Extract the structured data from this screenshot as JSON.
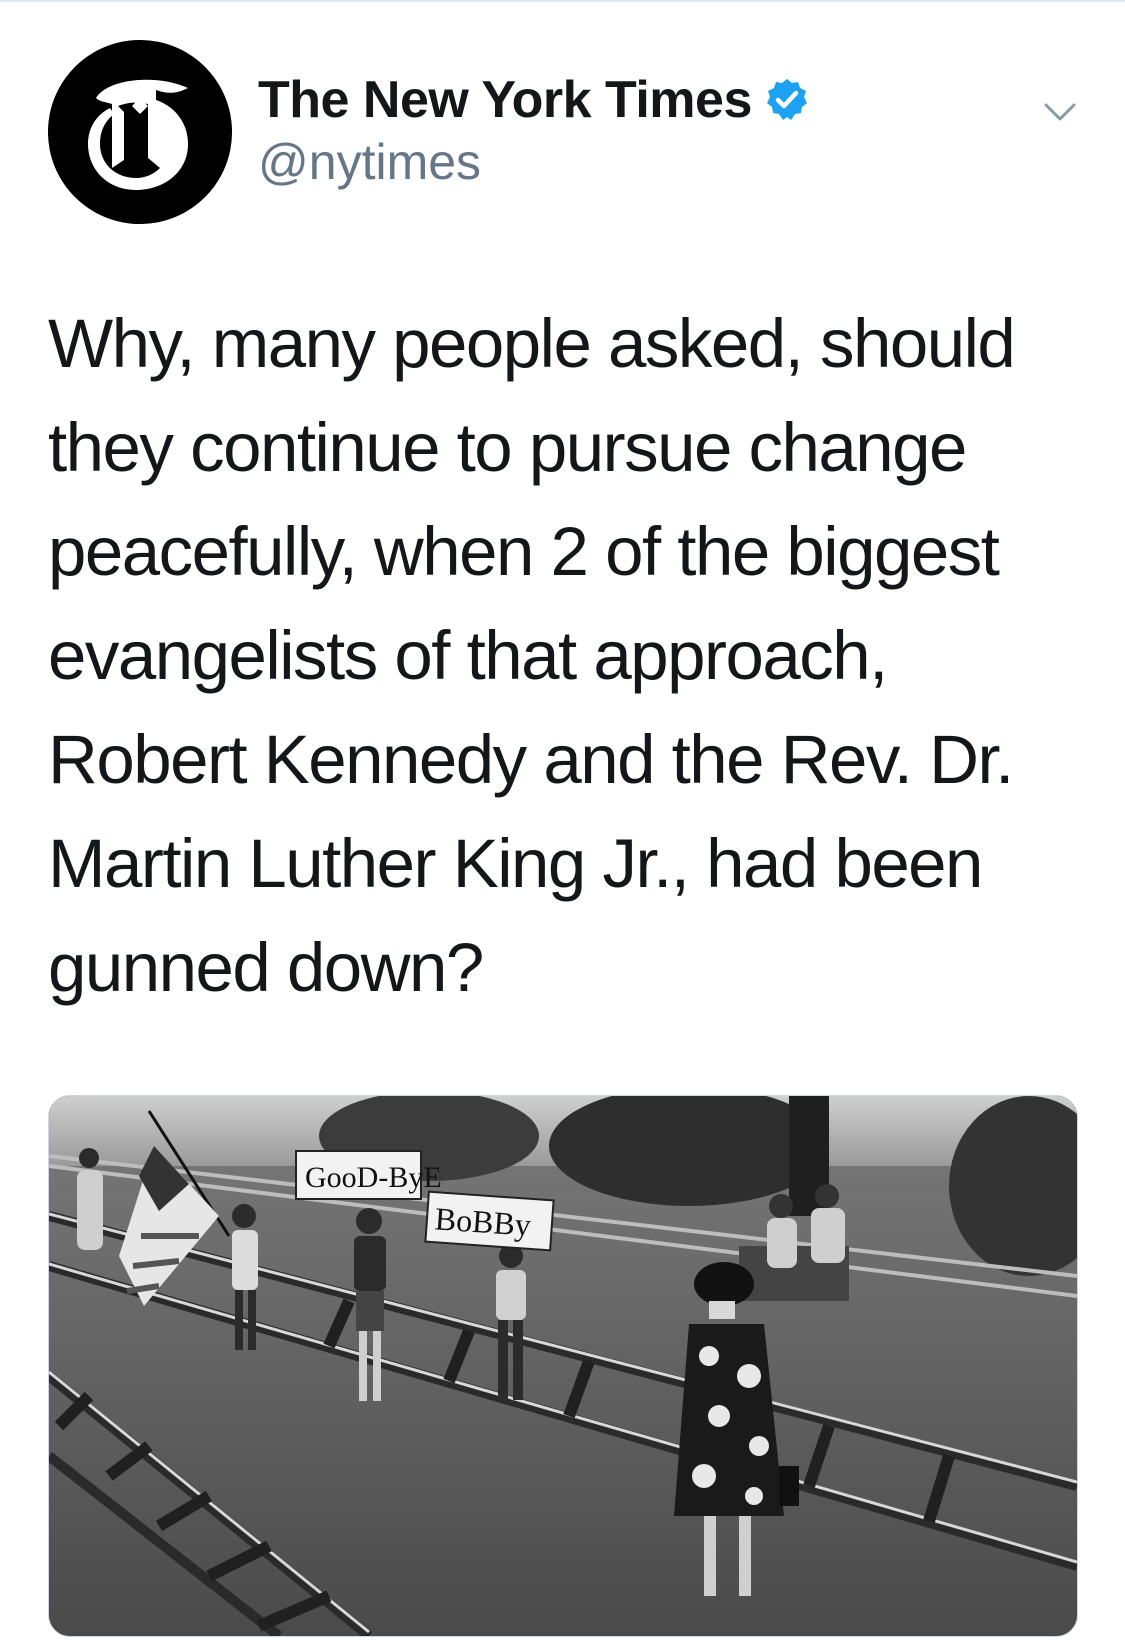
{
  "tweet": {
    "author": {
      "display_name": "The New York Times",
      "handle": "@nytimes",
      "verified": true,
      "avatar_icon": "nyt-t-logo-icon",
      "avatar_bg": "#000000",
      "verified_color": "#1da1f2"
    },
    "menu_icon": "chevron-down-icon",
    "text": "Why, many people asked, should they continue to pursue change peacefully, when 2 of the biggest evangelists of that approach, Robert Kennedy and the Rev. Dr. Martin Luther King Jr., had been gunned down?",
    "media": {
      "type": "photo",
      "sign_1": "GooD-ByE",
      "sign_2": "BoBBy"
    }
  },
  "colors": {
    "text_primary": "#14171a",
    "text_secondary": "#657786",
    "divider": "#e1e8ed"
  }
}
